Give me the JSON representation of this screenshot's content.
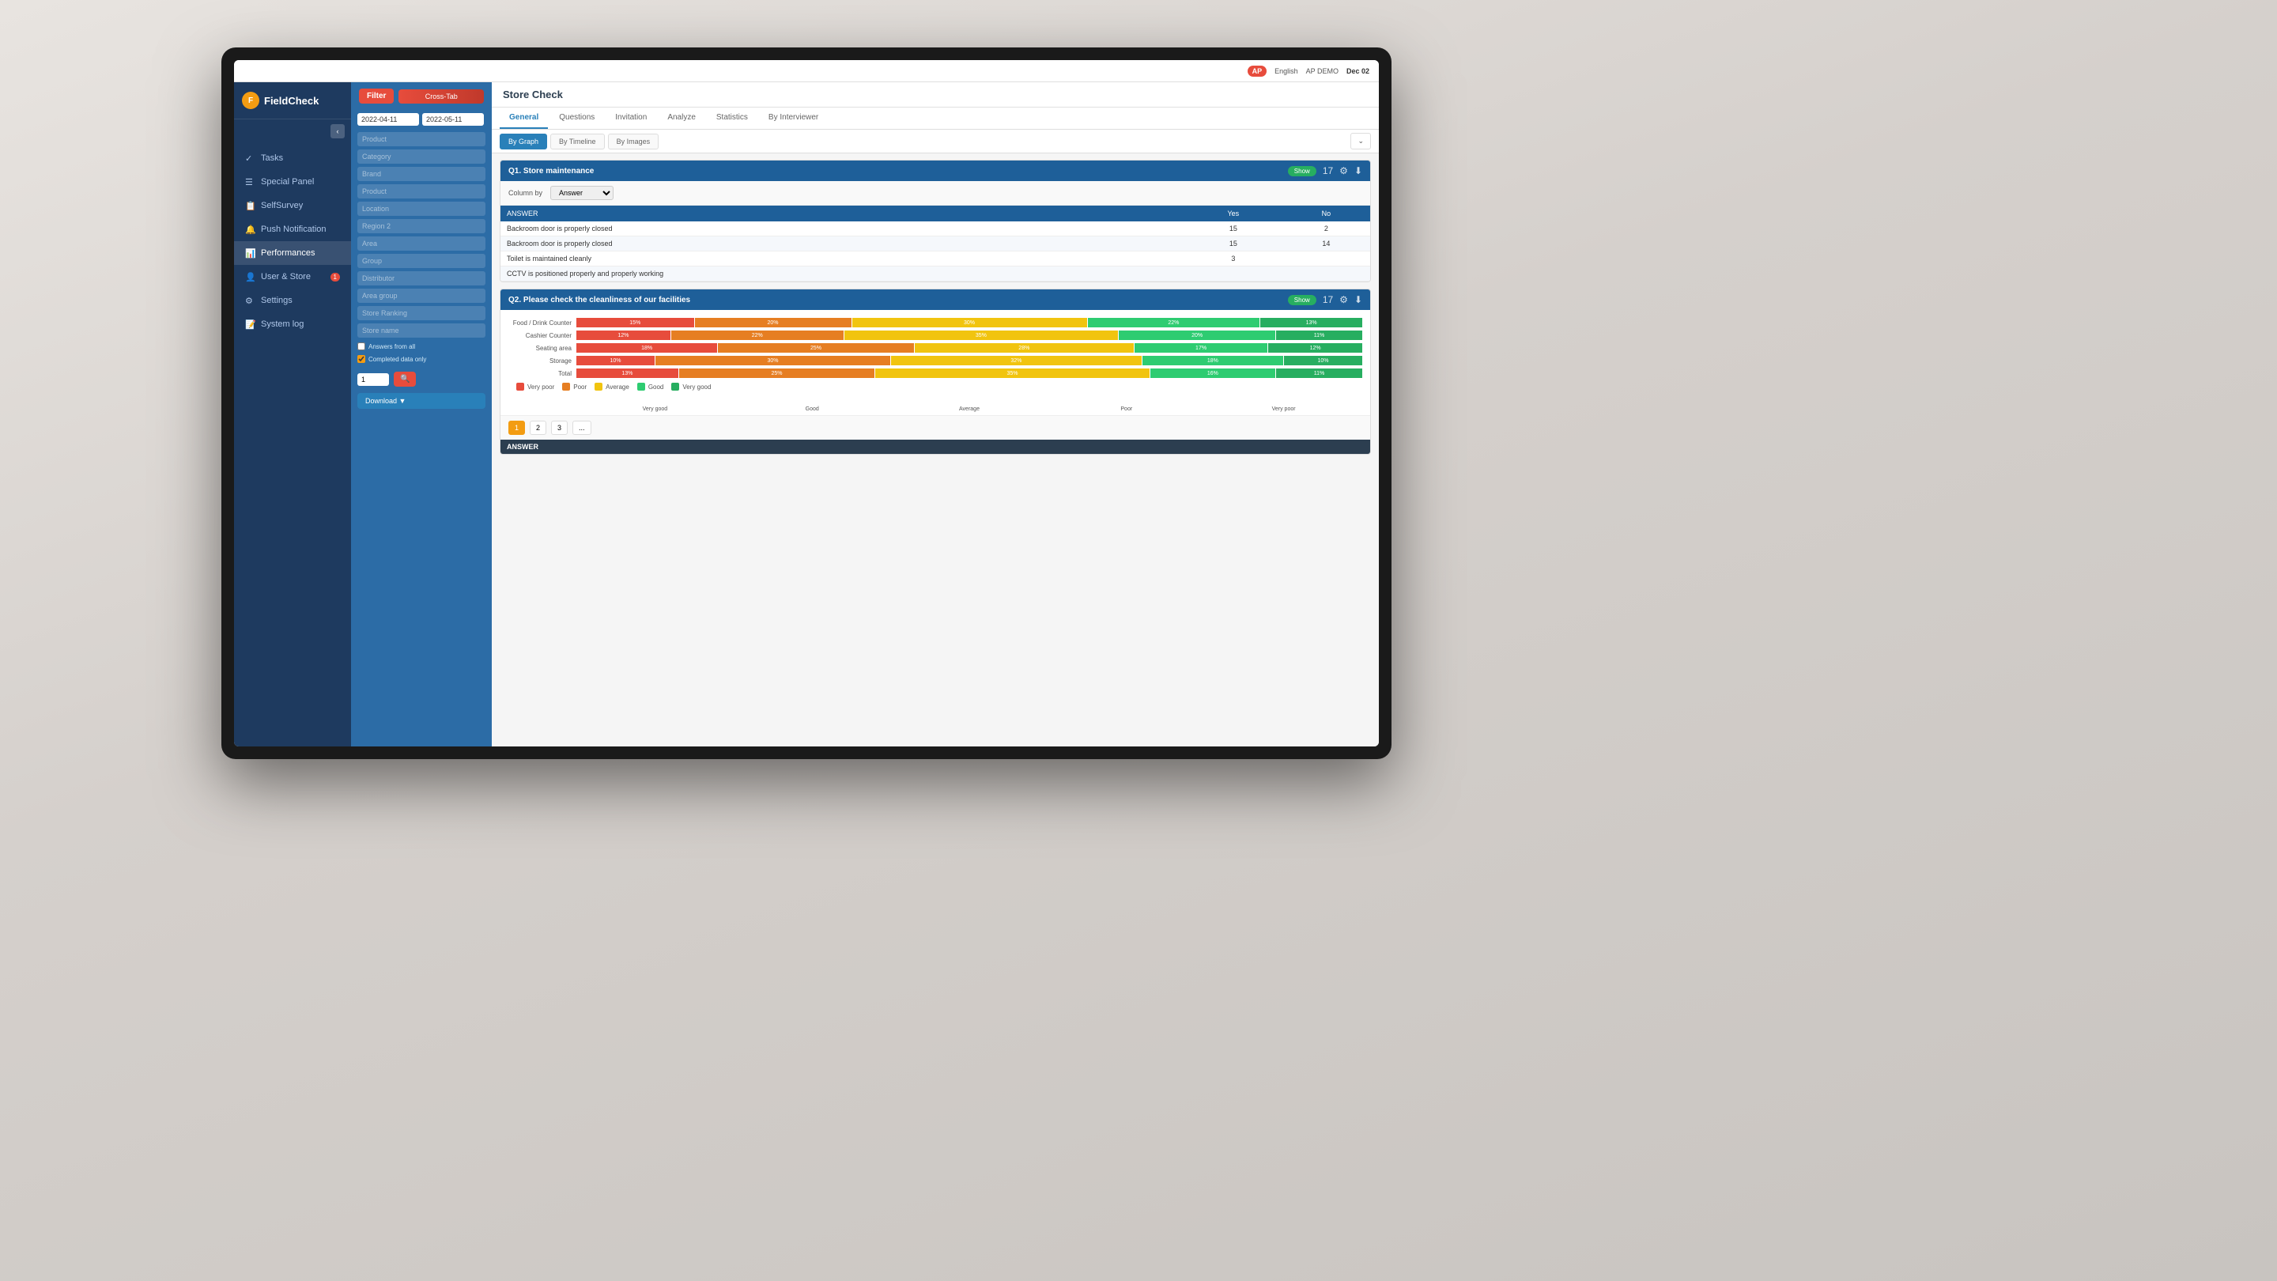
{
  "topbar": {
    "badge": "AP",
    "language": "English",
    "user": "AP DEMO",
    "date": "Dec 02"
  },
  "sidebar": {
    "logo_text": "FieldCheck",
    "items": [
      {
        "id": "tasks",
        "label": "Tasks",
        "icon": "✓",
        "active": false
      },
      {
        "id": "special-panel",
        "label": "Special Panel",
        "icon": "☰",
        "active": false
      },
      {
        "id": "self-survey",
        "label": "SelfSurvey",
        "icon": "📋",
        "active": false
      },
      {
        "id": "push-notification",
        "label": "Push Notification",
        "icon": "🔔",
        "active": false,
        "badge": ""
      },
      {
        "id": "performances",
        "label": "Performances",
        "icon": "📊",
        "active": true
      },
      {
        "id": "user-store",
        "label": "User & Store",
        "icon": "👤",
        "active": false,
        "badge": "1"
      },
      {
        "id": "settings",
        "label": "Settings",
        "icon": "⚙",
        "active": false
      },
      {
        "id": "system-log",
        "label": "System log",
        "icon": "📝",
        "active": false
      }
    ]
  },
  "filter": {
    "filter_label": "Filter",
    "cross_tab_label": "Cross-Tab",
    "date_from": "2022-04-11",
    "date_to": "2022-05-11",
    "fields": [
      {
        "id": "product",
        "label": "Product",
        "placeholder": "Product"
      },
      {
        "id": "category",
        "label": "Category",
        "placeholder": "Category"
      },
      {
        "id": "brand",
        "label": "Brand",
        "placeholder": "Brand"
      },
      {
        "id": "product2",
        "label": "Product",
        "placeholder": "Product"
      },
      {
        "id": "location",
        "label": "Location",
        "placeholder": "Location"
      },
      {
        "id": "region",
        "label": "Region 2",
        "placeholder": "Region 2"
      },
      {
        "id": "area",
        "label": "Area",
        "placeholder": "Area"
      },
      {
        "id": "group",
        "label": "Group",
        "placeholder": "Group"
      },
      {
        "id": "distributor",
        "label": "Distributor",
        "placeholder": "Distributor"
      },
      {
        "id": "area-group",
        "label": "Area group",
        "placeholder": "Area group"
      },
      {
        "id": "store-ranking",
        "label": "Store Ranking",
        "placeholder": "Store Ranking"
      },
      {
        "id": "store-name",
        "label": "Store name",
        "placeholder": "Store name"
      }
    ],
    "answers_from_all": "Answers from all",
    "completed_data": "Completed data only",
    "page_placeholder": "1",
    "download_label": "Download ▼"
  },
  "content": {
    "title": "Store Check",
    "tabs": [
      {
        "id": "general",
        "label": "General",
        "active": true
      },
      {
        "id": "questions",
        "label": "Questions",
        "active": false
      },
      {
        "id": "invitation",
        "label": "Invitation",
        "active": false
      },
      {
        "id": "analyze",
        "label": "Analyze",
        "active": false
      },
      {
        "id": "statistics",
        "label": "Statistics",
        "active": false
      },
      {
        "id": "by-interviewer",
        "label": "By Interviewer",
        "active": false
      }
    ],
    "subtabs": [
      {
        "id": "by-graph",
        "label": "By Graph",
        "active": true
      },
      {
        "id": "by-timeline",
        "label": "By Timeline",
        "active": false
      },
      {
        "id": "by-images",
        "label": "By Images",
        "active": false
      }
    ],
    "q1": {
      "title": "Q1. Store maintenance",
      "toggle_label": "Show",
      "column_by_label": "Column by",
      "column_option": "Answer",
      "columns": [
        "Yes",
        "No"
      ],
      "answer_label": "ANSWER",
      "rows": [
        {
          "label": "Backroom door is properly closed",
          "yes": "15",
          "no": "2"
        },
        {
          "label": "Backroom door is properly closed",
          "yes": "15",
          "no": "14"
        },
        {
          "label": "Toilet is maintained cleanly",
          "yes": "3",
          "no": ""
        },
        {
          "label": "CCTV is positioned properly and properly working",
          "yes": "",
          "no": ""
        }
      ]
    },
    "q2": {
      "title": "Q2. Please check the cleanliness of our facilities",
      "toggle_label": "Show",
      "answer_label": "ANSWER",
      "bars": [
        {
          "label": "Food / Drink Counter",
          "very_poor": 15,
          "poor": 20,
          "avg": 30,
          "good": 22,
          "very_good": 13
        },
        {
          "label": "Cashier Counter",
          "very_poor": 12,
          "poor": 22,
          "avg": 35,
          "good": 20,
          "very_good": 11
        },
        {
          "label": "Seating area",
          "very_poor": 18,
          "poor": 25,
          "avg": 28,
          "good": 17,
          "very_good": 12
        },
        {
          "label": "Storage",
          "very_poor": 10,
          "poor": 30,
          "avg": 32,
          "good": 18,
          "very_good": 10
        },
        {
          "label": "Total",
          "very_poor": 13,
          "poor": 25,
          "avg": 35,
          "good": 16,
          "very_good": 11
        }
      ],
      "legend": [
        {
          "id": "very-poor",
          "label": "Very poor",
          "color": "#e74c3c"
        },
        {
          "id": "poor",
          "label": "Poor",
          "color": "#e67e22"
        },
        {
          "id": "average",
          "label": "Average",
          "color": "#f1c40f"
        },
        {
          "id": "good",
          "label": "Good",
          "color": "#2ecc71"
        },
        {
          "id": "very-good",
          "label": "Very good",
          "color": "#27ae60"
        }
      ],
      "axis_labels": [
        "Very good",
        "Good",
        "Average",
        "Poor",
        "Very poor"
      ],
      "pagination": [
        "1",
        "2",
        "3",
        "..."
      ]
    }
  }
}
